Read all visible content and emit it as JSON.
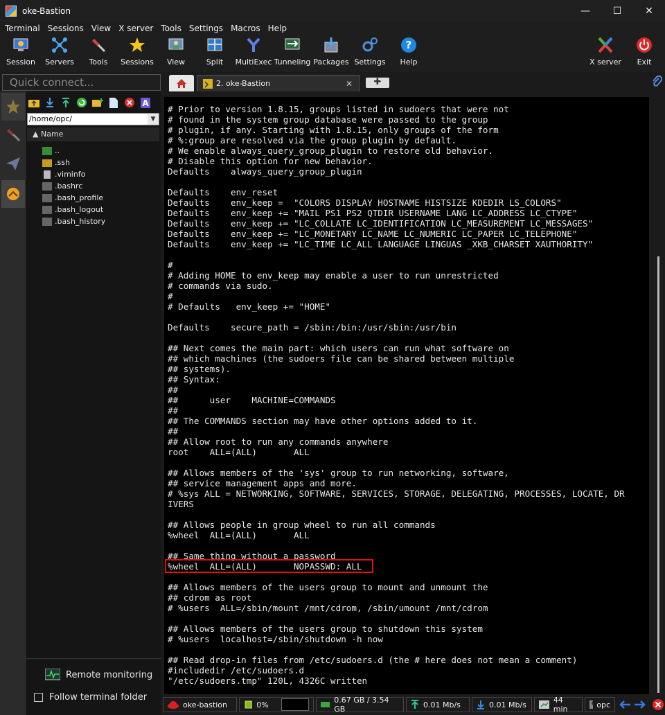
{
  "window": {
    "title": "oke-Bastion"
  },
  "menu": [
    "Terminal",
    "Sessions",
    "View",
    "X server",
    "Tools",
    "Settings",
    "Macros",
    "Help"
  ],
  "toolbar": [
    {
      "label": "Session",
      "icon": "session-icon"
    },
    {
      "label": "Servers",
      "icon": "servers-icon"
    },
    {
      "label": "Tools",
      "icon": "tools-icon"
    },
    {
      "label": "Sessions",
      "icon": "star-icon"
    },
    {
      "label": "View",
      "icon": "view-icon"
    },
    {
      "label": "Split",
      "icon": "split-icon"
    },
    {
      "label": "MultiExec",
      "icon": "multiexec-icon"
    },
    {
      "label": "Tunneling",
      "icon": "tunneling-icon"
    },
    {
      "label": "Packages",
      "icon": "packages-icon"
    },
    {
      "label": "Settings",
      "icon": "settings-icon"
    },
    {
      "label": "Help",
      "icon": "help-icon"
    },
    {
      "label": "X server",
      "icon": "xserver-icon"
    },
    {
      "label": "Exit",
      "icon": "exit-icon"
    }
  ],
  "quick_connect": {
    "placeholder": "Quick connect..."
  },
  "sidebar": {
    "path": "/home/opc/",
    "column_name": "Name",
    "files": [
      "..",
      ".ssh",
      ".viminfo",
      ".bashrc",
      ".bash_profile",
      ".bash_logout",
      ".bash_history"
    ],
    "remote_monitoring": "Remote monitoring",
    "follow_terminal": "Follow terminal folder"
  },
  "tabs": {
    "session_label": "2. oke-Bastion"
  },
  "terminal": {
    "lines": [
      "# Prior to version 1.8.15, groups listed in sudoers that were not",
      "# found in the system group database were passed to the group",
      "# plugin, if any. Starting with 1.8.15, only groups of the form",
      "# %:group are resolved via the group plugin by default.",
      "# We enable always_query_group_plugin to restore old behavior.",
      "# Disable this option for new behavior.",
      "Defaults    always_query_group_plugin",
      "",
      "Defaults    env_reset",
      "Defaults    env_keep =  \"COLORS DISPLAY HOSTNAME HISTSIZE KDEDIR LS_COLORS\"",
      "Defaults    env_keep += \"MAIL PS1 PS2 QTDIR USERNAME LANG LC_ADDRESS LC_CTYPE\"",
      "Defaults    env_keep += \"LC_COLLATE LC_IDENTIFICATION LC_MEASUREMENT LC_MESSAGES\"",
      "Defaults    env_keep += \"LC_MONETARY LC_NAME LC_NUMERIC LC_PAPER LC_TELEPHONE\"",
      "Defaults    env_keep += \"LC_TIME LC_ALL LANGUAGE LINGUAS _XKB_CHARSET XAUTHORITY\"",
      "",
      "#",
      "# Adding HOME to env_keep may enable a user to run unrestricted",
      "# commands via sudo.",
      "#",
      "# Defaults   env_keep += \"HOME\"",
      "",
      "Defaults    secure_path = /sbin:/bin:/usr/sbin:/usr/bin",
      "",
      "## Next comes the main part: which users can run what software on",
      "## which machines (the sudoers file can be shared between multiple",
      "## systems).",
      "## Syntax:",
      "##",
      "##      user    MACHINE=COMMANDS",
      "##",
      "## The COMMANDS section may have other options added to it.",
      "##",
      "## Allow root to run any commands anywhere",
      "root    ALL=(ALL)       ALL",
      "",
      "## Allows members of the 'sys' group to run networking, software,",
      "## service management apps and more.",
      "# %sys ALL = NETWORKING, SOFTWARE, SERVICES, STORAGE, DELEGATING, PROCESSES, LOCATE, DR",
      "IVERS",
      "",
      "## Allows people in group wheel to run all commands",
      "%wheel  ALL=(ALL)       ALL",
      "",
      "## Same thing without a password",
      "%wheel  ALL=(ALL)       NOPASSWD: ALL",
      "",
      "## Allows members of the users group to mount and unmount the",
      "## cdrom as root",
      "# %users  ALL=/sbin/mount /mnt/cdrom, /sbin/umount /mnt/cdrom",
      "",
      "## Allows members of the users group to shutdown this system",
      "# %users  localhost=/sbin/shutdown -h now",
      "",
      "## Read drop-in files from /etc/sudoers.d (the # here does not mean a comment)",
      "#includedir /etc/sudoers.d",
      "\"/etc/sudoers.tmp\" 120L, 4326C written"
    ]
  },
  "status": {
    "session": "oke-bastion",
    "cpu": "0%",
    "memory": "0.67 GB / 3.54 GB",
    "upload": "0.01 Mb/s",
    "download": "0.01 Mb/s",
    "uptime": "44 min",
    "user": "opc"
  }
}
